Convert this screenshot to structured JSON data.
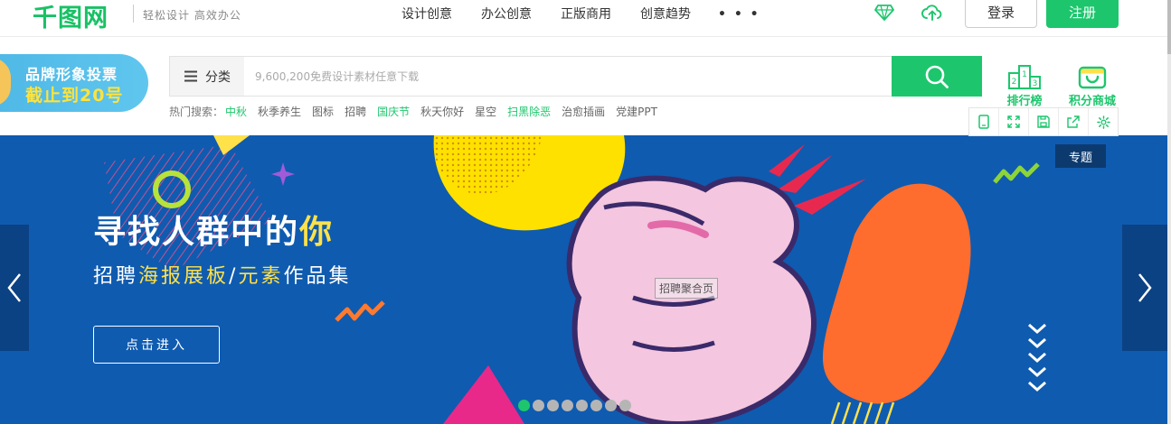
{
  "logo": {
    "text": "千图网"
  },
  "slogan": "轻松设计 高效办公",
  "nav": {
    "items": [
      "设计创意",
      "办公创意",
      "正版商用",
      "创意趋势"
    ],
    "more": "• • •",
    "login": "登录",
    "register": "注册"
  },
  "promo": {
    "line1": "品牌形象投票",
    "line2": "截止到20号"
  },
  "search": {
    "category_label": "分类",
    "placeholder": "9,600,200免费设计素材任意下载"
  },
  "hot_search": {
    "label": "热门搜索：",
    "items": [
      {
        "text": "中秋",
        "highlight": true
      },
      {
        "text": "秋季养生",
        "highlight": false
      },
      {
        "text": "图标",
        "highlight": false
      },
      {
        "text": "招聘",
        "highlight": false
      },
      {
        "text": "国庆节",
        "highlight": true
      },
      {
        "text": "秋天你好",
        "highlight": false
      },
      {
        "text": "星空",
        "highlight": false
      },
      {
        "text": "扫黑除恶",
        "highlight": true
      },
      {
        "text": "治愈插画",
        "highlight": false
      },
      {
        "text": "党建PPT",
        "highlight": false
      }
    ]
  },
  "side_links": {
    "rank": "排行榜",
    "rank_digits": [
      "2",
      "1",
      "3"
    ],
    "points_mall": "积分商城"
  },
  "banner": {
    "title_main": "寻找人群中的",
    "title_highlight": "你",
    "sub_prefix": "招聘",
    "sub_hl1": "海报展板",
    "sub_sep": "/",
    "sub_hl2": "元素",
    "sub_suffix": "作品集",
    "button": "点击进入",
    "tag": "专题",
    "tooltip": "招聘聚合页",
    "dot_count": 8,
    "active_dot": 0
  },
  "colors": {
    "brand_green": "#1dc66d",
    "banner_blue": "#0f5bb0",
    "highlight_yellow": "#ffe14a"
  }
}
